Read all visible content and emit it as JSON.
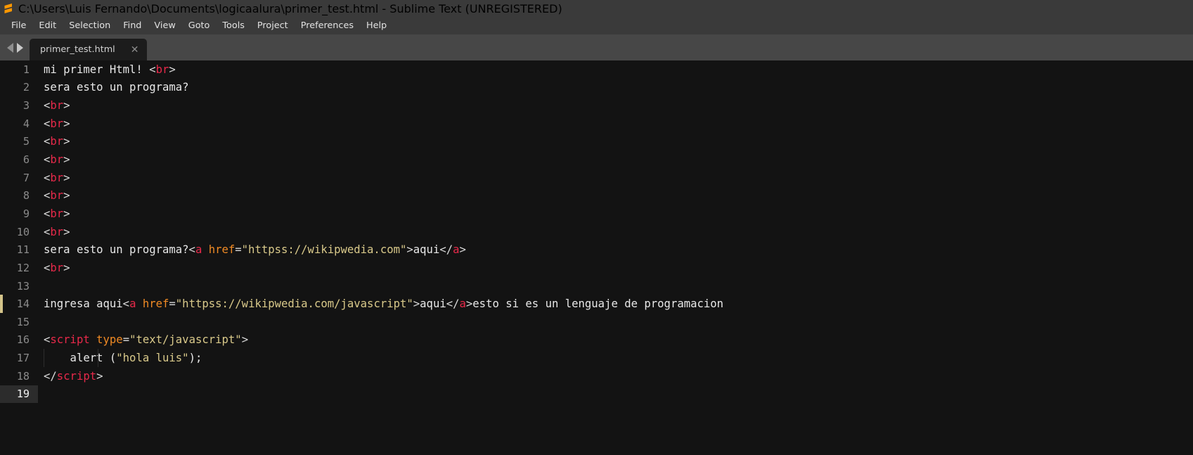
{
  "window": {
    "title": "C:\\Users\\Luis Fernando\\Documents\\logicaalura\\primer_test.html - Sublime Text (UNREGISTERED)",
    "logo_icon": "sublime-text-logo-icon"
  },
  "menubar": {
    "items": [
      {
        "label": "File"
      },
      {
        "label": "Edit"
      },
      {
        "label": "Selection"
      },
      {
        "label": "Find"
      },
      {
        "label": "View"
      },
      {
        "label": "Goto"
      },
      {
        "label": "Tools"
      },
      {
        "label": "Project"
      },
      {
        "label": "Preferences"
      },
      {
        "label": "Help"
      }
    ]
  },
  "tabbar": {
    "prev_icon": "chevron-left-icon",
    "next_icon": "chevron-right-icon",
    "tabs": [
      {
        "label": "primer_test.html",
        "close_icon": "close-icon",
        "active": true
      }
    ]
  },
  "editor": {
    "active_line": 19,
    "modified_marker_line": 14,
    "modified_marker_color": "#d4c48a",
    "colors": {
      "background": "#131313",
      "text": "#e8e8e8",
      "tag": "#e8294a",
      "attribute": "#f08a24",
      "string": "#d9c98a",
      "punctuation": "#d9d9d9",
      "linenumber": "#8a8a8a",
      "active_linenumber": "#f2f2f2",
      "active_gutter": "#2c2c2c"
    },
    "lines": [
      {
        "n": 1,
        "tokens": [
          {
            "t": "mi primer Html! ",
            "c": "plain"
          },
          {
            "t": "<",
            "c": "punct"
          },
          {
            "t": "br",
            "c": "tag"
          },
          {
            "t": ">",
            "c": "punct"
          }
        ]
      },
      {
        "n": 2,
        "tokens": [
          {
            "t": "sera esto un programa?",
            "c": "plain"
          }
        ]
      },
      {
        "n": 3,
        "tokens": [
          {
            "t": "<",
            "c": "punct"
          },
          {
            "t": "br",
            "c": "tag"
          },
          {
            "t": ">",
            "c": "punct"
          }
        ]
      },
      {
        "n": 4,
        "tokens": [
          {
            "t": "<",
            "c": "punct"
          },
          {
            "t": "br",
            "c": "tag"
          },
          {
            "t": ">",
            "c": "punct"
          }
        ]
      },
      {
        "n": 5,
        "tokens": [
          {
            "t": "<",
            "c": "punct"
          },
          {
            "t": "br",
            "c": "tag"
          },
          {
            "t": ">",
            "c": "punct"
          }
        ]
      },
      {
        "n": 6,
        "tokens": [
          {
            "t": "<",
            "c": "punct"
          },
          {
            "t": "br",
            "c": "tag"
          },
          {
            "t": ">",
            "c": "punct"
          }
        ]
      },
      {
        "n": 7,
        "tokens": [
          {
            "t": "<",
            "c": "punct"
          },
          {
            "t": "br",
            "c": "tag"
          },
          {
            "t": ">",
            "c": "punct"
          }
        ]
      },
      {
        "n": 8,
        "tokens": [
          {
            "t": "<",
            "c": "punct"
          },
          {
            "t": "br",
            "c": "tag"
          },
          {
            "t": ">",
            "c": "punct"
          }
        ]
      },
      {
        "n": 9,
        "tokens": [
          {
            "t": "<",
            "c": "punct"
          },
          {
            "t": "br",
            "c": "tag"
          },
          {
            "t": ">",
            "c": "punct"
          }
        ]
      },
      {
        "n": 10,
        "tokens": [
          {
            "t": "<",
            "c": "punct"
          },
          {
            "t": "br",
            "c": "tag"
          },
          {
            "t": ">",
            "c": "punct"
          }
        ]
      },
      {
        "n": 11,
        "tokens": [
          {
            "t": "sera esto un programa?",
            "c": "plain"
          },
          {
            "t": "<",
            "c": "punct"
          },
          {
            "t": "a",
            "c": "tag"
          },
          {
            "t": " ",
            "c": "plain"
          },
          {
            "t": "href",
            "c": "attr"
          },
          {
            "t": "=",
            "c": "punct"
          },
          {
            "t": "\"httpss://wikipwedia.com\"",
            "c": "string"
          },
          {
            "t": ">",
            "c": "punct"
          },
          {
            "t": "aqui",
            "c": "plain"
          },
          {
            "t": "</",
            "c": "punct"
          },
          {
            "t": "a",
            "c": "tag"
          },
          {
            "t": ">",
            "c": "punct"
          }
        ]
      },
      {
        "n": 12,
        "tokens": [
          {
            "t": "<",
            "c": "punct"
          },
          {
            "t": "br",
            "c": "tag"
          },
          {
            "t": ">",
            "c": "punct"
          }
        ]
      },
      {
        "n": 13,
        "tokens": []
      },
      {
        "n": 14,
        "tokens": [
          {
            "t": "ingresa aqui",
            "c": "plain"
          },
          {
            "t": "<",
            "c": "punct"
          },
          {
            "t": "a",
            "c": "tag"
          },
          {
            "t": " ",
            "c": "plain"
          },
          {
            "t": "href",
            "c": "attr"
          },
          {
            "t": "=",
            "c": "punct"
          },
          {
            "t": "\"httpss://wikipwedia.com/javascript\"",
            "c": "string"
          },
          {
            "t": ">",
            "c": "punct"
          },
          {
            "t": "aqui",
            "c": "plain"
          },
          {
            "t": "</",
            "c": "punct"
          },
          {
            "t": "a",
            "c": "tag"
          },
          {
            "t": ">",
            "c": "punct"
          },
          {
            "t": "esto si es un lenguaje de programacion",
            "c": "plain"
          }
        ]
      },
      {
        "n": 15,
        "tokens": []
      },
      {
        "n": 16,
        "tokens": [
          {
            "t": "<",
            "c": "punct"
          },
          {
            "t": "script",
            "c": "tag"
          },
          {
            "t": " ",
            "c": "plain"
          },
          {
            "t": "type",
            "c": "attr"
          },
          {
            "t": "=",
            "c": "punct"
          },
          {
            "t": "\"text/javascript\"",
            "c": "string"
          },
          {
            "t": ">",
            "c": "punct"
          }
        ]
      },
      {
        "n": 17,
        "tokens": [
          {
            "t": "    alert (",
            "c": "plain"
          },
          {
            "t": "\"hola luis\"",
            "c": "string"
          },
          {
            "t": ");",
            "c": "plain"
          }
        ],
        "indent_guides": [
          0,
          2
        ]
      },
      {
        "n": 18,
        "tokens": [
          {
            "t": "</",
            "c": "punct"
          },
          {
            "t": "script",
            "c": "tag"
          },
          {
            "t": ">",
            "c": "punct"
          }
        ]
      },
      {
        "n": 19,
        "tokens": []
      }
    ]
  }
}
